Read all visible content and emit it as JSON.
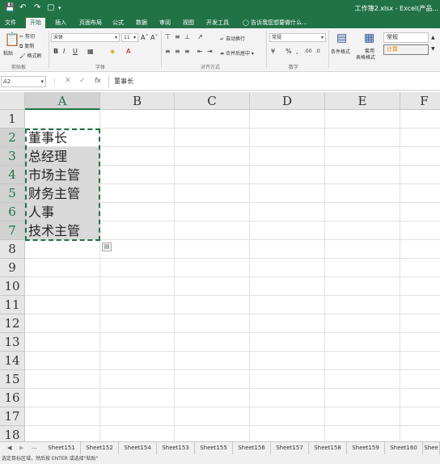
{
  "title_bar": {
    "document_title": "工作簿2.xlsx - Excel(产品..."
  },
  "tabs": [
    "文件",
    "开始",
    "插入",
    "页面布局",
    "公式",
    "数据",
    "审阅",
    "视图",
    "开发工具"
  ],
  "active_tab": "开始",
  "tell_me": "告诉我您想要做什么...",
  "ribbon": {
    "paste_label": "粘贴",
    "cut_label": "剪切",
    "copy_label": "复制",
    "format_painter_label": "格式刷",
    "clipboard_group": "剪贴板",
    "font_name": "宋体",
    "font_size": "11",
    "bold": "B",
    "italic": "I",
    "underline": "U",
    "font_group": "字体",
    "wrap_text_label": "自动换行",
    "merge_center_label": "合并后居中",
    "alignment_group": "对齐方式",
    "number_format": "常规",
    "number_group": "数字",
    "conditional_format_label": "条件格式",
    "table_format_label1": "套用",
    "table_format_label2": "表格格式",
    "style_normal": "常规",
    "style_calc": "计算"
  },
  "formula_bar": {
    "name_box": "A2",
    "fx": "fx",
    "content": "董事长"
  },
  "columns": [
    "A",
    "B",
    "C",
    "D",
    "E",
    "F"
  ],
  "rows": [
    "1",
    "2",
    "3",
    "4",
    "5",
    "6",
    "7",
    "8",
    "9",
    "10",
    "11",
    "12",
    "13",
    "14",
    "15",
    "16",
    "17",
    "18"
  ],
  "cells": {
    "A1": "",
    "A2": "董事长",
    "A3": "总经理",
    "A4": "市场主管",
    "A5": "财务主管",
    "A6": "人事",
    "A7": "技术主管"
  },
  "sheets": [
    "Sheet151",
    "Sheet152",
    "Sheet154",
    "Sheet153",
    "Sheet155",
    "Sheet156",
    "Sheet157",
    "Sheet158",
    "Sheet159",
    "Sheet160",
    "Shee"
  ],
  "sheet_nav_ellipsis": "...",
  "status_text": "选定目标区域，然后按 ENTER 或选择\"粘贴\""
}
